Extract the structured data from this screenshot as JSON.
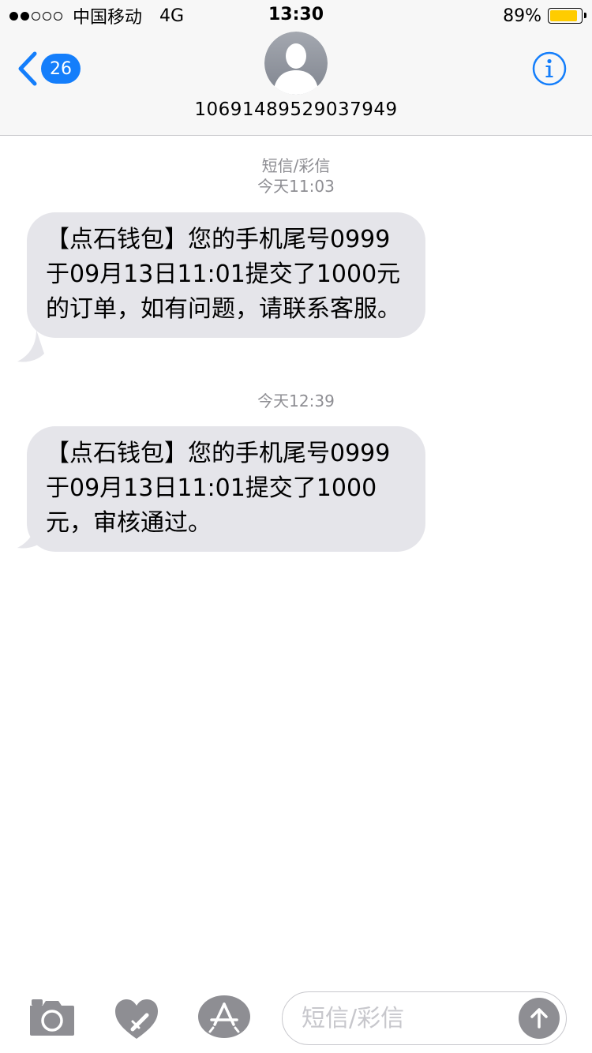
{
  "status_bar": {
    "carrier": "中国移动",
    "network": "4G",
    "time": "13:30",
    "battery_percent": "89%",
    "battery_level": 0.89,
    "signal_bars_filled": 2,
    "signal_bars_total": 5
  },
  "header": {
    "back_badge_count": "26",
    "contact_name": "10691489529037949"
  },
  "thread": {
    "messages": [
      {
        "service_label": "短信/彩信",
        "timestamp": "今天11:03",
        "text": "【点石钱包】您的手机尾号0999于09月13日11:01提交了1000元的订单，如有问题，请联系客服。"
      },
      {
        "timestamp": "今天12:39",
        "text": "【点石钱包】您的手机尾号0999于09月13日11:01提交了1000元，审核通过。"
      }
    ]
  },
  "composer": {
    "placeholder": "短信/彩信"
  },
  "colors": {
    "accent": "#147efb",
    "bubble": "#e5e5ea",
    "timestamp": "#8e8e93",
    "battery": "#ffcc00",
    "icon_gray": "#8e8e93"
  }
}
